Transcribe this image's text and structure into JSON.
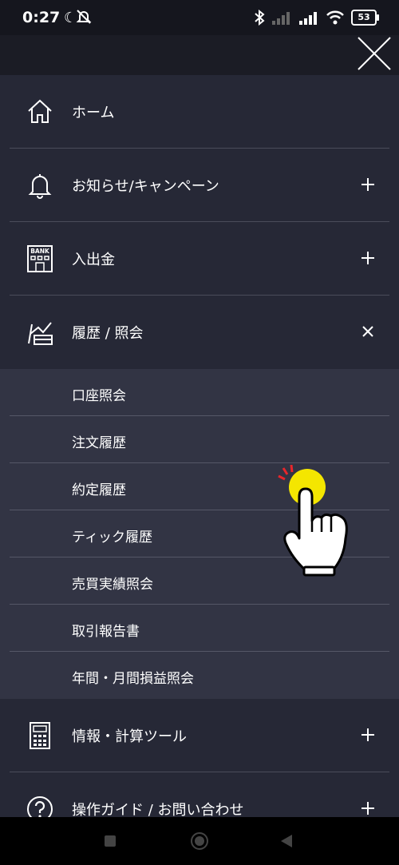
{
  "status_bar": {
    "time": "0:27",
    "battery": "53"
  },
  "menu": {
    "home": "ホーム",
    "news": "お知らせ/キャンペーン",
    "deposit": "入出金",
    "history": "履歴 / 照会",
    "history_sub": [
      "口座照会",
      "注文履歴",
      "約定履歴",
      "ティック履歴",
      "売買実績照会",
      "取引報告書",
      "年間・月間損益照会"
    ],
    "info": "情報・計算ツール",
    "guide": "操作ガイド / お問い合わせ"
  },
  "icons": {
    "bank_text": "BANK"
  },
  "colors": {
    "background": "#262836",
    "submenu_background": "#323444",
    "status_bar": "#15161e",
    "cursor_yellow": "#f4e600"
  }
}
